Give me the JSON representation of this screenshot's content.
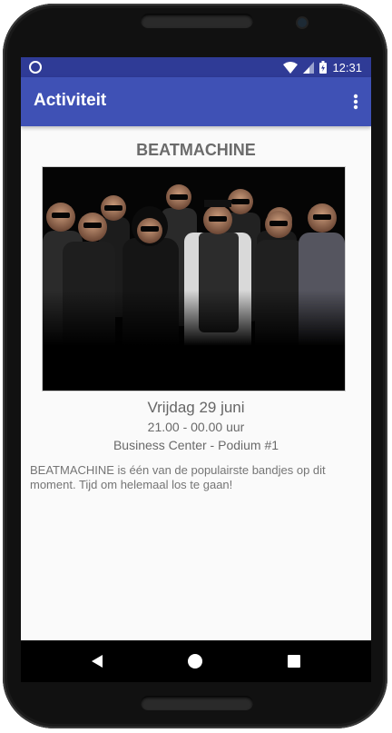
{
  "status_bar": {
    "time": "12:31",
    "icons": [
      "circle-notification-icon",
      "wifi-icon",
      "signal-icon",
      "battery-icon"
    ],
    "color": "#2f3b96"
  },
  "app_bar": {
    "title": "Activiteit",
    "menu_icon": "overflow-menu-icon",
    "color": "#3f51b5"
  },
  "event": {
    "title": "BEATMACHINE",
    "date": "Vrijdag 29 juni",
    "time": "21.00 - 00.00 uur",
    "location": "Business Center - Podium #1",
    "description": "BEATMACHINE is één van de populairste bandjes op dit moment. Tijd om helemaal los te gaan!"
  },
  "nav_bar": {
    "icons": [
      "back-icon",
      "home-icon",
      "recents-icon"
    ]
  }
}
